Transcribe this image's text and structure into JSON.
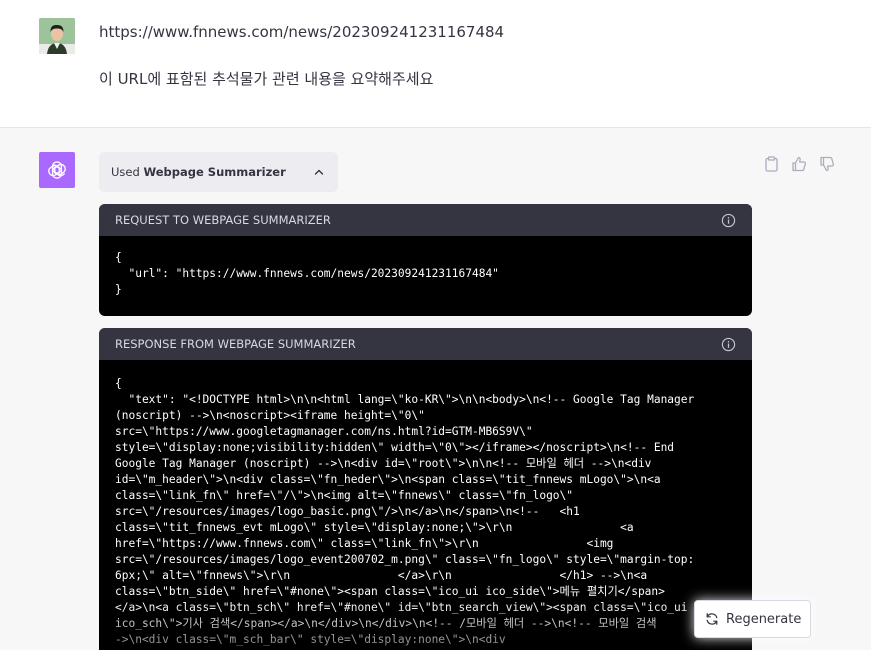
{
  "user_message": {
    "avatar": "user-avatar-photo",
    "line1": "https://www.fnnews.com/news/202309241231167484",
    "line2": "이 URL에 표함된 추석물가 관련 내용을 요약해주세요"
  },
  "assistant": {
    "logo": "openai-logo-icon",
    "plugin_chip": {
      "prefix": "Used ",
      "plugin_name": "Webpage Summarizer",
      "chevron": "chevron-up-icon"
    },
    "actions": {
      "copy": "clipboard-icon",
      "like": "thumbs-up-icon",
      "dislike": "thumbs-down-icon"
    },
    "request": {
      "title": "REQUEST TO WEBPAGE SUMMARIZER",
      "info_icon": "info-icon",
      "body": "{\n  \"url\": \"https://www.fnnews.com/news/202309241231167484\"\n}"
    },
    "response": {
      "title": "RESPONSE FROM WEBPAGE SUMMARIZER",
      "info_icon": "info-icon",
      "body": "{\n  \"text\": \"<!DOCTYPE html>\\n\\n<html lang=\\\"ko-KR\\\">\\n\\n<body>\\n<!-- Google Tag Manager\n(noscript) -->\\n<noscript><iframe height=\\\"0\\\"\nsrc=\\\"https://www.googletagmanager.com/ns.html?id=GTM-MB6S9V\\\"\nstyle=\\\"display:none;visibility:hidden\\\" width=\\\"0\\\"></iframe></noscript>\\n<!-- End\nGoogle Tag Manager (noscript) -->\\n<div id=\\\"root\\\">\\n\\n<!-- 모바일 헤더 -->\\n<div\nid=\\\"m_header\\\">\\n<div class=\\\"fn_heder\\\">\\n<span class=\\\"tit_fnnews mLogo\\\">\\n<a\nclass=\\\"link_fn\\\" href=\\\"/\\\">\\n<img alt=\\\"fnnews\\\" class=\\\"fn_logo\\\"\nsrc=\\\"/resources/images/logo_basic.png\\\"/>\\n</a>\\n</span>\\n<!--   <h1\nclass=\\\"tit_fnnews_evt mLogo\\\" style=\\\"display:none;\\\">\\r\\n                <a\nhref=\\\"https://www.fnnews.com\\\" class=\\\"link_fn\\\">\\r\\n                <img\nsrc=\\\"/resources/images/logo_event200702_m.png\\\" class=\\\"fn_logo\\\" style=\\\"margin-top:\n6px;\\\" alt=\\\"fnnews\\\">\\r\\n                </a>\\r\\n                </h1> -->\\n<a\nclass=\\\"btn_side\\\" href=\\\"#none\\\"><span class=\\\"ico_ui ico_side\\\">메뉴 펼치기</span>\n</a>\\n<a class=\\\"btn_sch\\\" href=\\\"#none\\\" id=\\\"btn_search_view\\\"><span class=\\\"ico_ui\nico_sch\\\">기사 검색</span></a>\\n</div>\\n</div>\\n<!-- /모바일 헤더 -->\\n<!-- 모바일 검색\n->\\n<div class=\\\"m_sch_bar\\\" style=\\\"display:none\\\">\\n<div"
    }
  },
  "regenerate": {
    "label": "Regenerate",
    "icon": "refresh-icon"
  }
}
